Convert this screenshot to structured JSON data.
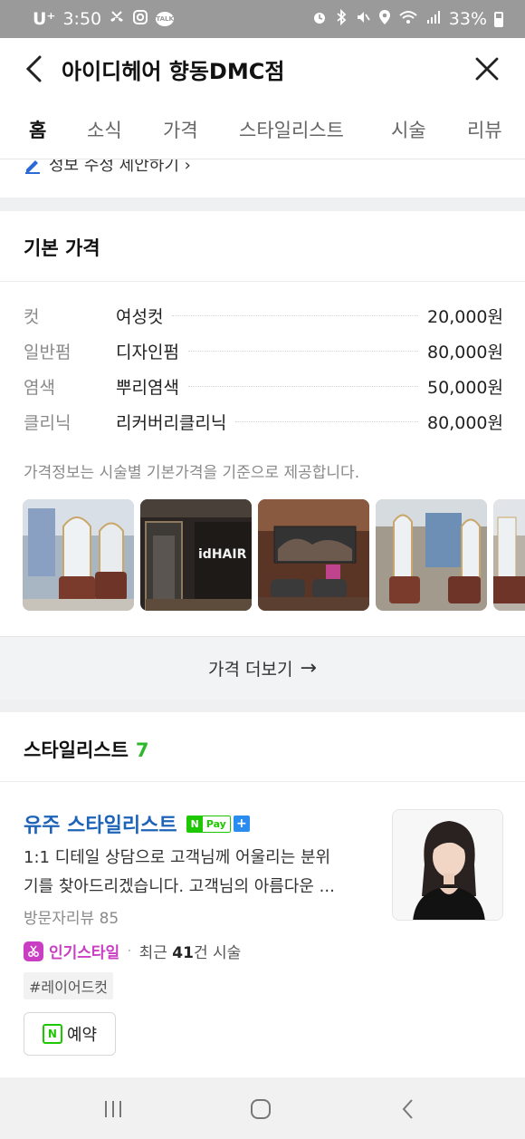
{
  "status_bar": {
    "carrier": "U⁺",
    "time": "3:50",
    "battery": "33%",
    "talk_label": "TALK"
  },
  "header": {
    "title": "아이디헤어 향동DMC점"
  },
  "tabs": [
    {
      "label": "홈",
      "active": true
    },
    {
      "label": "소식",
      "active": false
    },
    {
      "label": "가격",
      "active": false
    },
    {
      "label": "스타일리스트",
      "active": false
    },
    {
      "label": "시술",
      "active": false
    },
    {
      "label": "리뷰",
      "active": false
    }
  ],
  "edit_suggest": {
    "label": "정보 수정 제안하기 ›"
  },
  "price_section": {
    "title": "기본 가격",
    "rows": [
      {
        "category": "컷",
        "name": "여성컷",
        "price": "20,000원"
      },
      {
        "category": "일반펌",
        "name": "디자인펌",
        "price": "80,000원"
      },
      {
        "category": "염색",
        "name": "뿌리염색",
        "price": "50,000원"
      },
      {
        "category": "클리닉",
        "name": "리커버리클리닉",
        "price": "80,000원"
      }
    ],
    "note": "가격정보는 시술별 기본가격을 기준으로 제공합니다.",
    "photo_text": "idHAIR",
    "more_label": "가격 더보기",
    "more_arrow": "→"
  },
  "stylist_section": {
    "title": "스타일리스트",
    "count": "7",
    "stylist": {
      "name": "유주 스타일리스트",
      "npay_n": "N",
      "npay_label": "Pay",
      "npay_plus": "+",
      "desc_line1": "1:1 디테일 상담으로 고객님께 어울리는 분위",
      "desc_line2": "기를 찾아드리겠습니다. 고객님의 아름다운 ...",
      "reviews": "방문자리뷰 85",
      "popular_label": "인기스타일",
      "recent_prefix": "최근 ",
      "recent_count": "41",
      "recent_suffix": "건 시술",
      "hashtag": "#레이어드컷",
      "reserve_icon": "N",
      "reserve_label": "예약"
    }
  },
  "colors": {
    "accent_blue": "#1d63b8",
    "naver_green": "#1ec800",
    "popular_purple": "#c93ec2",
    "count_green": "#2eb82e"
  }
}
